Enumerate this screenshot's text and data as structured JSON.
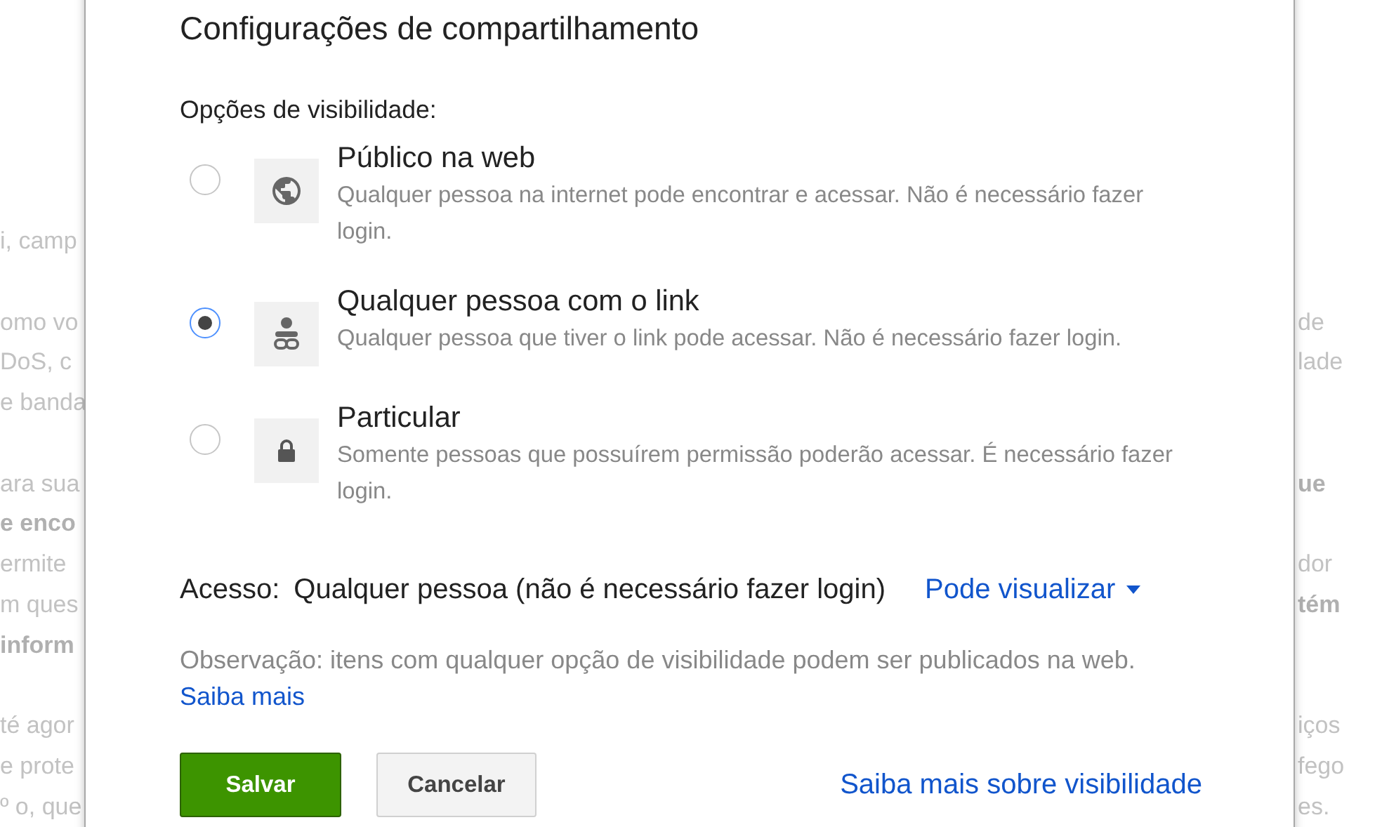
{
  "background_text": {
    "paragraphs": [
      [
        {
          "left": {
            "text": "i, camp",
            "bold": false
          }
        }
      ],
      [
        {
          "left": {
            "text": "omo vo",
            "bold": false
          },
          "right": {
            "text": "de",
            "bold": false
          }
        },
        {
          "left": {
            "text": "DoS, c",
            "bold": false
          },
          "right": {
            "text": "lade",
            "bold": false
          }
        },
        {
          "left": {
            "text": "e banda",
            "bold": false
          }
        }
      ],
      [
        {
          "left": {
            "text": "ara sua",
            "bold": false
          },
          "right": {
            "text": "ue",
            "bold": true
          }
        },
        {
          "left": {
            "text": "e enco",
            "bold": true
          }
        },
        {
          "left": {
            "text": "ermite",
            "bold": false
          },
          "right": {
            "text": "dor",
            "bold": false
          }
        },
        {
          "left": {
            "text": "m ques",
            "bold": false
          },
          "right": {
            "text": "tém",
            "bold": true
          }
        },
        {
          "left": {
            "text": "inform",
            "bold": true
          }
        }
      ],
      [
        {
          "left": {
            "text": "té agor",
            "bold": false
          },
          "right": {
            "text": "iços",
            "bold": false
          }
        },
        {
          "left": {
            "text": "e prote",
            "bold": false
          },
          "right": {
            "text": "fego",
            "bold": false
          }
        },
        {
          "left": {
            "text": "º o, que",
            "bold": false
          },
          "right": {
            "text": "es.",
            "bold": false
          }
        }
      ]
    ]
  },
  "dialog": {
    "title": "Configurações de compartilhamento",
    "visibility_label": "Opções de visibilidade:",
    "options": [
      {
        "kind": "globe",
        "title": "Público na web",
        "description": "Qualquer pessoa na internet pode encontrar e acessar. Não é necessário fazer login.",
        "selected": false
      },
      {
        "kind": "person-link",
        "title": "Qualquer pessoa com o link",
        "description": "Qualquer pessoa que tiver o link pode acessar. Não é necessário fazer login.",
        "selected": true
      },
      {
        "kind": "lock",
        "title": "Particular",
        "description": "Somente pessoas que possuírem permissão poderão acessar. É necessário fazer login.",
        "selected": false
      }
    ],
    "access": {
      "label": "Acesso:",
      "value": "Qualquer pessoa (não é necessário fazer login)",
      "permission": "Pode visualizar"
    },
    "note": {
      "text": "Observação: itens com qualquer opção de visibilidade podem ser publicados na web.",
      "link": "Saiba mais"
    },
    "buttons": [
      {
        "label": "Salvar",
        "kind": "primary"
      },
      {
        "label": "Cancelar",
        "kind": "secondary"
      }
    ],
    "help_link": "Saiba mais sobre visibilidade"
  }
}
